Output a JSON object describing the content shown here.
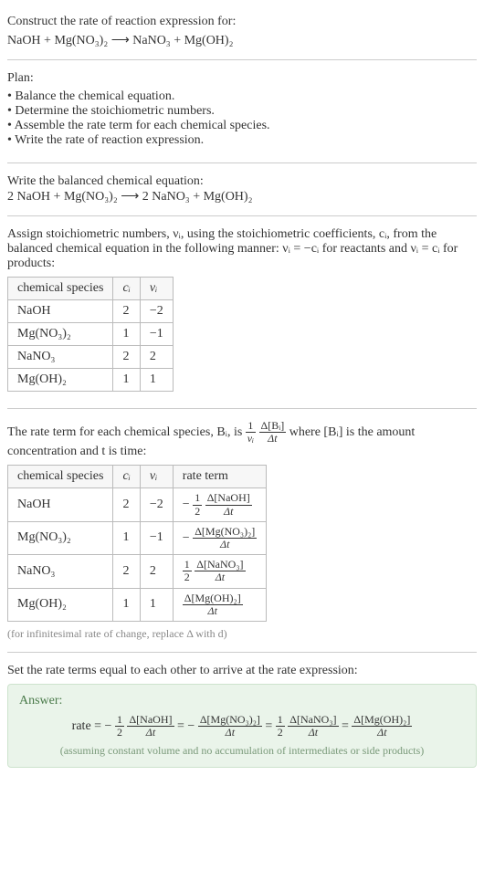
{
  "prompt": {
    "title": "Construct the rate of reaction expression for:",
    "equation": "NaOH + Mg(NO₃)₂ ⟶ NaNO₃ + Mg(OH)₂"
  },
  "plan": {
    "heading": "Plan:",
    "items": [
      "Balance the chemical equation.",
      "Determine the stoichiometric numbers.",
      "Assemble the rate term for each chemical species.",
      "Write the rate of reaction expression."
    ]
  },
  "balanced": {
    "heading": "Write the balanced chemical equation:",
    "equation": "2 NaOH + Mg(NO₃)₂ ⟶ 2 NaNO₃ + Mg(OH)₂"
  },
  "stoich": {
    "intro": "Assign stoichiometric numbers, νᵢ, using the stoichiometric coefficients, cᵢ, from the balanced chemical equation in the following manner: νᵢ = −cᵢ for reactants and νᵢ = cᵢ for products:",
    "headers": {
      "species": "chemical species",
      "ci": "cᵢ",
      "vi": "νᵢ"
    },
    "rows": [
      {
        "species": "NaOH",
        "ci": "2",
        "vi": "−2"
      },
      {
        "species": "Mg(NO₃)₂",
        "ci": "1",
        "vi": "−1"
      },
      {
        "species": "NaNO₃",
        "ci": "2",
        "vi": "2"
      },
      {
        "species": "Mg(OH)₂",
        "ci": "1",
        "vi": "1"
      }
    ]
  },
  "rateterm": {
    "intro_a": "The rate term for each chemical species, Bᵢ, is ",
    "intro_b": " where [Bᵢ] is the amount concentration and t is time:",
    "headers": {
      "species": "chemical species",
      "ci": "cᵢ",
      "vi": "νᵢ",
      "term": "rate term"
    },
    "rows": [
      {
        "species": "NaOH",
        "ci": "2",
        "vi": "−2",
        "term_prefix": "− ",
        "term_coef_num": "1",
        "term_coef_den": "2",
        "term_num": "Δ[NaOH]",
        "term_den": "Δt"
      },
      {
        "species": "Mg(NO₃)₂",
        "ci": "1",
        "vi": "−1",
        "term_prefix": "− ",
        "term_coef_num": "",
        "term_coef_den": "",
        "term_num": "Δ[Mg(NO₃)₂]",
        "term_den": "Δt"
      },
      {
        "species": "NaNO₃",
        "ci": "2",
        "vi": "2",
        "term_prefix": "",
        "term_coef_num": "1",
        "term_coef_den": "2",
        "term_num": "Δ[NaNO₃]",
        "term_den": "Δt"
      },
      {
        "species": "Mg(OH)₂",
        "ci": "1",
        "vi": "1",
        "term_prefix": "",
        "term_coef_num": "",
        "term_coef_den": "",
        "term_num": "Δ[Mg(OH)₂]",
        "term_den": "Δt"
      }
    ],
    "note": "(for infinitesimal rate of change, replace Δ with d)"
  },
  "final": {
    "heading": "Set the rate terms equal to each other to arrive at the rate expression:",
    "answer_label": "Answer:",
    "rate_word": "rate = ",
    "answer_note": "(assuming constant volume and no accumulation of intermediates or side products)"
  },
  "generic_frac": {
    "one_over_vi_num": "1",
    "one_over_vi_den": "νᵢ",
    "dB_num": "Δ[Bᵢ]",
    "dB_den": "Δt"
  }
}
